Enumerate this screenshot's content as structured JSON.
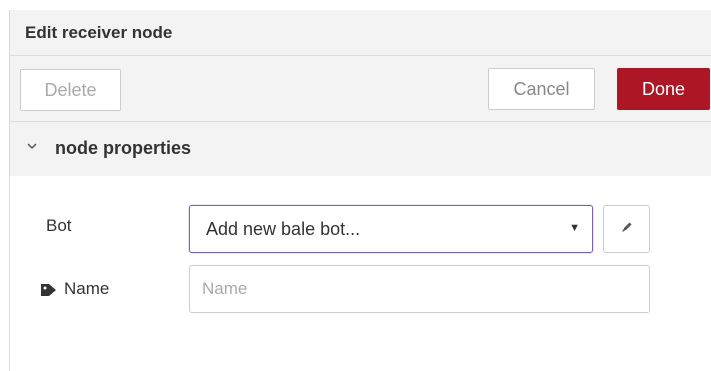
{
  "dialog": {
    "title": "Edit receiver node"
  },
  "toolbar": {
    "delete_label": "Delete",
    "cancel_label": "Cancel",
    "done_label": "Done"
  },
  "section": {
    "title": "node properties",
    "expanded": true
  },
  "form": {
    "bot_label": "Bot",
    "bot_selected": "Add new bale bot...",
    "name_label": "Name",
    "name_value": "",
    "name_placeholder": "Name"
  },
  "icons": {
    "section_toggle": "chevron-down-icon",
    "select_caret": "caret-down-icon",
    "edit": "pencil-icon",
    "name": "tag-icon"
  },
  "colors": {
    "done_button": "#ad1625",
    "select_border": "#7a5fb3",
    "panel_background": "#f3f3f3"
  }
}
